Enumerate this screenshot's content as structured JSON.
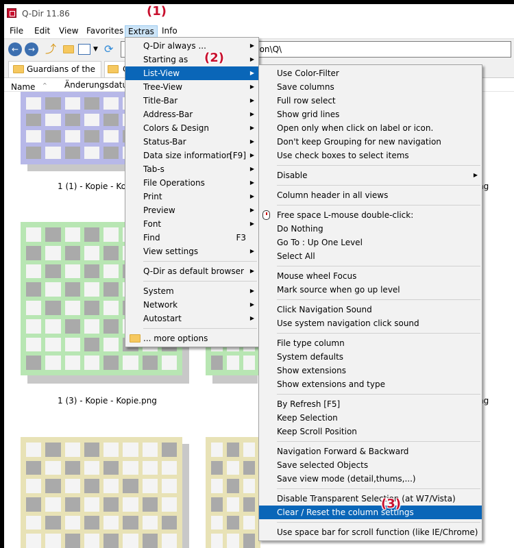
{
  "window": {
    "title": "Q-Dir 11.86"
  },
  "menubar": [
    {
      "label": "File"
    },
    {
      "label": "Edit"
    },
    {
      "label": "View"
    },
    {
      "label": "Favorites"
    },
    {
      "label": "Extras"
    },
    {
      "label": "Info"
    }
  ],
  "address": {
    "value": "g\\icon\\Q\\"
  },
  "tabs": [
    {
      "label": "Guardians of the ..."
    },
    {
      "label": "C"
    }
  ],
  "columns": [
    {
      "label": "Name"
    },
    {
      "label": "Änderungsdatum"
    }
  ],
  "files": [
    {
      "label": "1 (1) - Kopie - Kopie"
    },
    {
      "label": "ng"
    },
    {
      "label": "1 (3) - Kopie - Kopie.png"
    },
    {
      "label": "ng"
    }
  ],
  "extras_menu": [
    {
      "label": "Q-Dir always ...",
      "submenu": true
    },
    {
      "label": "Starting as",
      "submenu": true
    },
    {
      "label": "List-View",
      "submenu": true,
      "highlighted": true
    },
    {
      "label": "Tree-View",
      "submenu": true
    },
    {
      "label": "Title-Bar",
      "submenu": true
    },
    {
      "label": "Address-Bar",
      "submenu": true
    },
    {
      "label": "Colors & Design",
      "submenu": true
    },
    {
      "label": "Status-Bar",
      "submenu": true
    },
    {
      "label": "Data size information",
      "shortcut": "[F9]",
      "submenu": true
    },
    {
      "label": "Tab-s",
      "submenu": true
    },
    {
      "label": "File Operations",
      "submenu": true
    },
    {
      "label": "Print",
      "submenu": true
    },
    {
      "label": "Preview",
      "submenu": true
    },
    {
      "label": "Font",
      "submenu": true
    },
    {
      "label": "Find",
      "shortcut": "F3"
    },
    {
      "label": "View settings",
      "submenu": true
    },
    {
      "separator": true
    },
    {
      "label": "Q-Dir as default browser",
      "submenu": true
    },
    {
      "separator": true
    },
    {
      "label": "System",
      "submenu": true
    },
    {
      "label": "Network",
      "submenu": true
    },
    {
      "label": "Autostart",
      "submenu": true
    },
    {
      "separator": true
    },
    {
      "label": "... more options",
      "icon": "folder-icon"
    }
  ],
  "listview_menu": [
    {
      "label": "Use Color-Filter"
    },
    {
      "label": "Save columns"
    },
    {
      "label": "Full row select"
    },
    {
      "label": "Show grid lines"
    },
    {
      "label": "Open only when click on label or icon."
    },
    {
      "label": "Don't keep Grouping for new navigation"
    },
    {
      "label": "Use check boxes to select items"
    },
    {
      "separator": true
    },
    {
      "label": "Disable",
      "submenu": true
    },
    {
      "separator": true
    },
    {
      "label": "Column header in all views"
    },
    {
      "separator": true
    },
    {
      "label": "Free space L-mouse double-click:",
      "icon": "mouse-icon"
    },
    {
      "label": "Do Nothing"
    },
    {
      "label": "Go To : Up One Level"
    },
    {
      "label": "Select All"
    },
    {
      "separator": true
    },
    {
      "label": "Mouse wheel Focus"
    },
    {
      "label": "Mark source when go up level"
    },
    {
      "separator": true
    },
    {
      "label": "Click Navigation Sound"
    },
    {
      "label": "Use system navigation click sound"
    },
    {
      "separator": true
    },
    {
      "label": "File type column"
    },
    {
      "label": "System defaults"
    },
    {
      "label": "Show extensions"
    },
    {
      "label": "Show extensions and type"
    },
    {
      "separator": true
    },
    {
      "label": "By Refresh [F5]"
    },
    {
      "label": "Keep Selection"
    },
    {
      "label": "Keep Scroll Position"
    },
    {
      "separator": true
    },
    {
      "label": "Navigation Forward & Backward"
    },
    {
      "label": "Save selected Objects"
    },
    {
      "label": "Save view mode (detail,thums,...)"
    },
    {
      "separator": true
    },
    {
      "label": "Disable Transparent Selection (at W7/Vista)"
    },
    {
      "label": "Clear / Reset the column settings",
      "highlighted": true
    },
    {
      "separator": true
    },
    {
      "label": "Use space bar for scroll function (like IE/Chrome)"
    }
  ],
  "annotations": [
    {
      "label": "(1)"
    },
    {
      "label": "(2)"
    },
    {
      "label": "(3)"
    }
  ],
  "colors": {
    "highlight": "#0a66b8",
    "annotation": "#c8102e",
    "tile_blue": "#b7b8e8",
    "tile_green": "#b8e6b3",
    "tile_yellow": "#e8e2b6"
  }
}
